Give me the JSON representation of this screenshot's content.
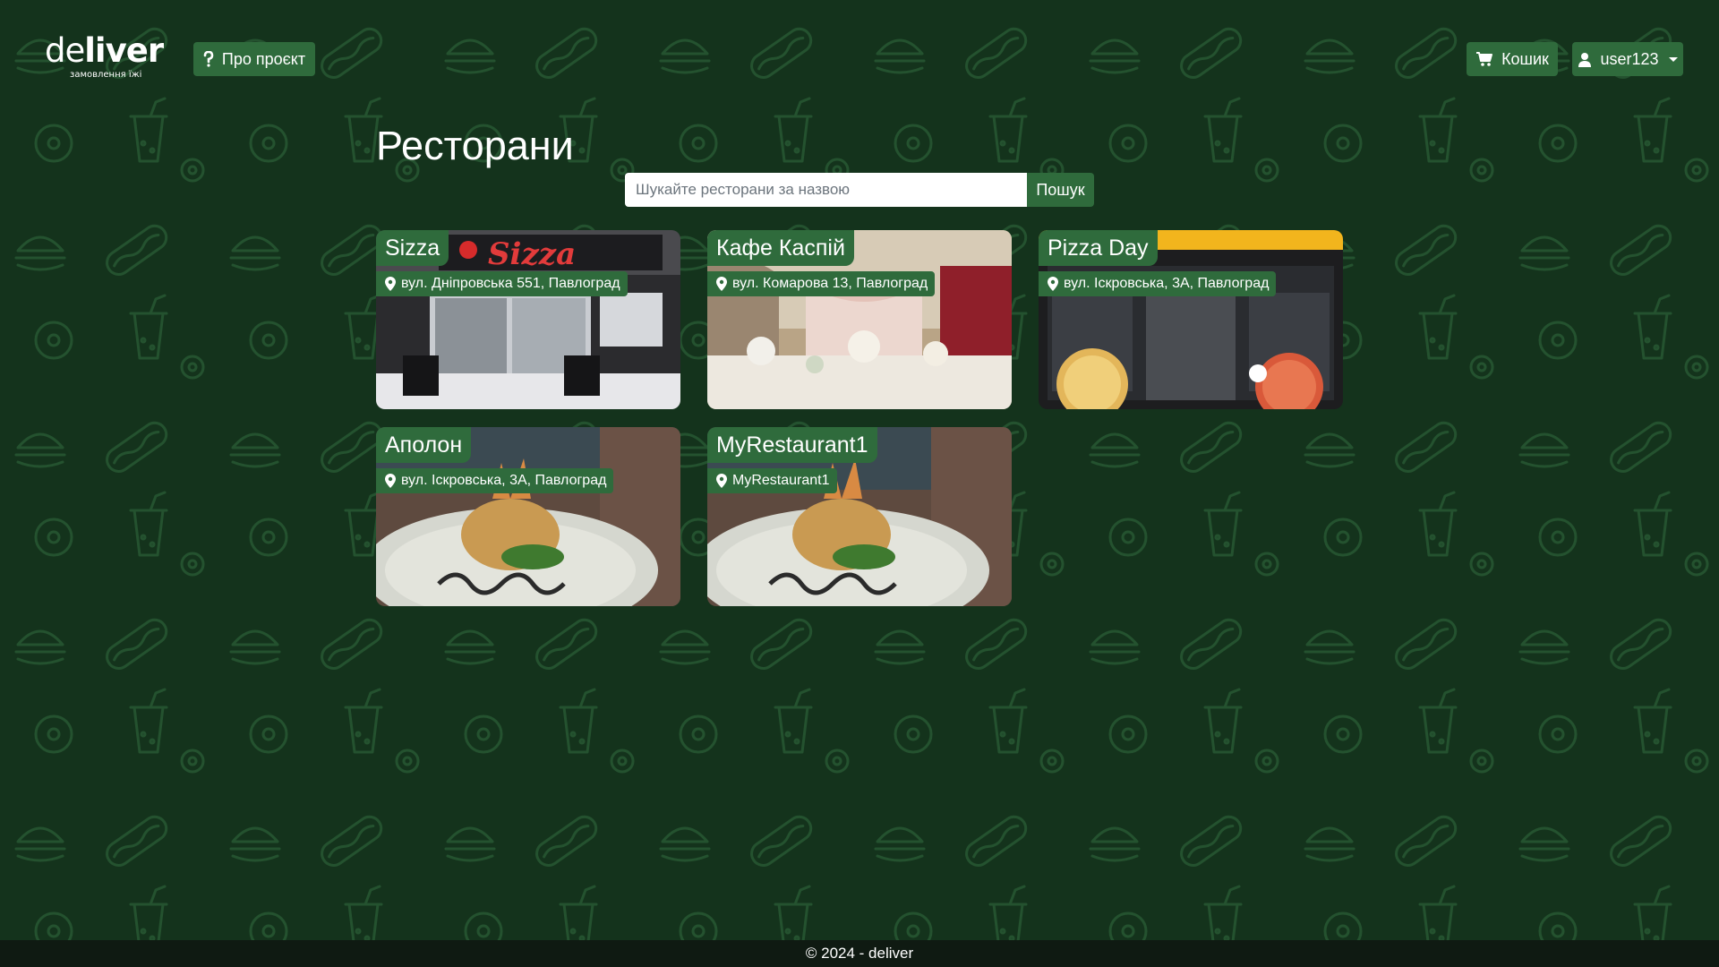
{
  "logo": {
    "part1": "de",
    "part2": "liver",
    "subtitle": "замовлення їжі"
  },
  "nav": {
    "about_label": "Про проєкт",
    "cart_label": "Кошик",
    "user_label": "user123"
  },
  "main": {
    "title": "Ресторани",
    "search": {
      "placeholder": "Шукайте ресторани за назвою",
      "value": "",
      "button_label": "Пошук"
    },
    "restaurants": [
      {
        "name": "Sizza",
        "address": "вул. Дніпровська 551, Павлоград"
      },
      {
        "name": "Кафе Каспій",
        "address": "вул. Комарова 13, Павлоград"
      },
      {
        "name": "Pizza Day",
        "address": "вул. Іскровська, 3А, Павлоград"
      },
      {
        "name": "Аполон",
        "address": "вул. Іскровська, 3А, Павлоград"
      },
      {
        "name": "MyRestaurant1",
        "address": "MyRestaurant1"
      }
    ]
  },
  "footer": {
    "text": "© 2024 - deliver"
  },
  "colors": {
    "background": "#14331c",
    "accent": "#2f6b3c",
    "pattern": "#24522f",
    "footer": "#0f1a12"
  },
  "icons": [
    "question-icon",
    "cart-icon",
    "user-icon",
    "map-pin-icon",
    "caret-down-icon"
  ]
}
